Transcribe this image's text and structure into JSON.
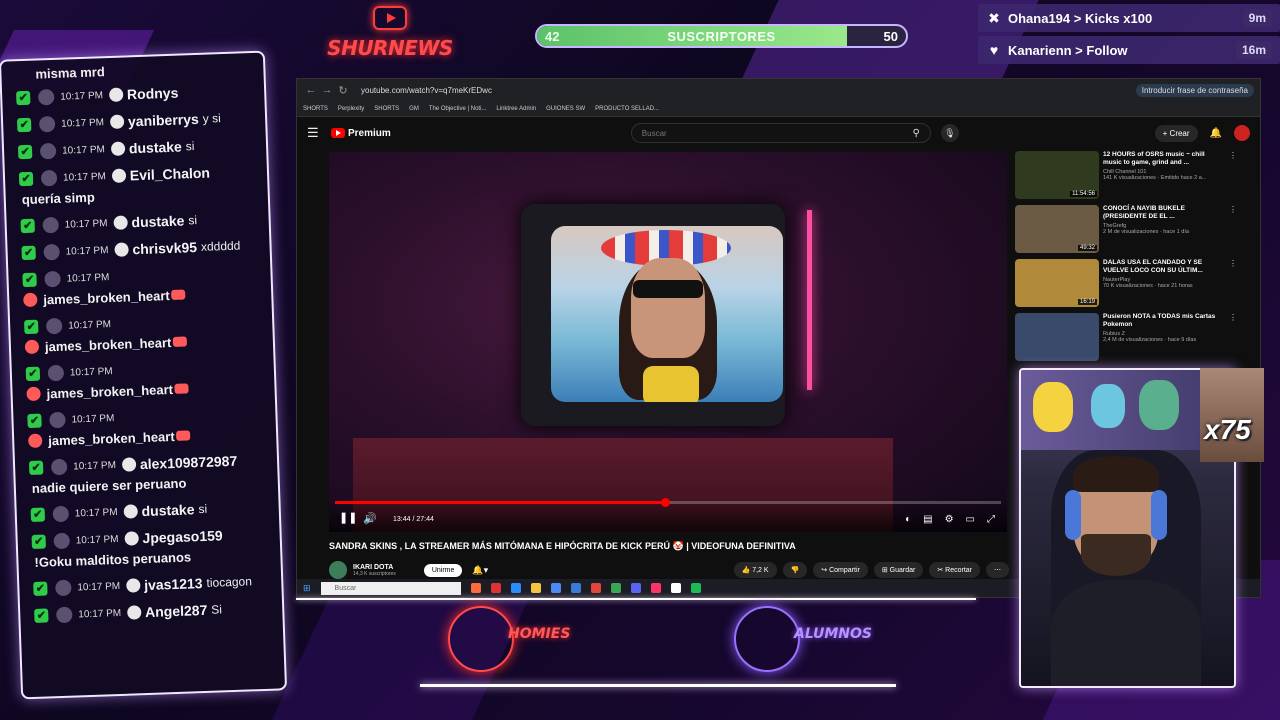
{
  "overlay": {
    "brand": "SHURNEWS",
    "subscribers": {
      "current": "42",
      "label": "SUSCRIPTORES",
      "goal": "50",
      "progress_fraction": 0.84
    },
    "alerts": [
      {
        "icon": "kick-icon",
        "text": "Ohana194 > Kicks x100",
        "time": "9m"
      },
      {
        "icon": "heart-icon",
        "text": "Kanarienn > Follow",
        "time": "16m"
      }
    ],
    "multiplier": "x75",
    "bottom_logos": {
      "homies": "HOMIES",
      "alumnos": "ALUMNOS"
    }
  },
  "chat": {
    "header_fragment": "misma mrd",
    "messages": [
      {
        "time": "10:17 PM",
        "user": "Rodnys",
        "text": "",
        "line2": ""
      },
      {
        "time": "10:17 PM",
        "user": "yaniberrys",
        "text": "y si",
        "line2": ""
      },
      {
        "time": "10:17 PM",
        "user": "dustake",
        "text": "si",
        "line2": ""
      },
      {
        "time": "10:17 PM",
        "user": "Evil_Chalon",
        "text": "",
        "line2": "quería simp"
      },
      {
        "time": "10:17 PM",
        "user": "dustake",
        "text": "si",
        "line2": ""
      },
      {
        "time": "10:17 PM",
        "user": "chrisvk95",
        "text": "xddddd",
        "line2": ""
      },
      {
        "time": "10:17 PM",
        "user": "",
        "text": "",
        "line2": "james_broken_heart"
      },
      {
        "time": "10:17 PM",
        "user": "",
        "text": "",
        "line2": "james_broken_heart"
      },
      {
        "time": "10:17 PM",
        "user": "",
        "text": "",
        "line2": "james_broken_heart"
      },
      {
        "time": "10:17 PM",
        "user": "",
        "text": "",
        "line2": "james_broken_heart"
      },
      {
        "time": "10:17 PM",
        "user": "alex109872987",
        "text": "",
        "line2": "nadie quiere ser peruano"
      },
      {
        "time": "10:17 PM",
        "user": "dustake",
        "text": "si",
        "line2": ""
      },
      {
        "time": "10:17 PM",
        "user": "Jpegaso159",
        "text": "",
        "line2": "!Goku malditos peruanos"
      },
      {
        "time": "10:17 PM",
        "user": "jvas1213",
        "text": "tiocagon",
        "line2": ""
      },
      {
        "time": "10:17 PM",
        "user": "Angel287",
        "text": "Si",
        "line2": ""
      }
    ]
  },
  "browser": {
    "url": "youtube.com/watch?v=q7meKrEDwc",
    "password_chip": "Introducir frase de contraseña",
    "bookmarks": [
      "SHORTS",
      "Perplexity",
      "SHORTS",
      "GM",
      "The Objective | Noti...",
      "Linktree Admin",
      "GUIONES SW",
      "PRODUCTO SELLAD..."
    ],
    "youtube": {
      "logo": "Premium",
      "search_placeholder": "Buscar",
      "create": "+ Crear",
      "time": "13:44 / 27:44",
      "progress_fraction": 0.495,
      "title": "SANDRA SKINS , LA STREAMER MÁS MITÓMANA E HIPÓCRITA DE KICK PERÚ 🤡 | VIDEOFUNA DEFINITIVA",
      "channel": "IKARI DOTA",
      "channel_subs": "14,3 K suscriptores",
      "join": "Unirme",
      "likes": "7,2 K",
      "share": "Compartir",
      "save": "Guardar",
      "clip": "Recortar",
      "recommendations": [
        {
          "title": "12 HOURS of OSRS music ~ chill music to game, grind and ...",
          "channel": "Chill Channel 101",
          "views": "141 K visualizaciones · Emitido hace 2 a...",
          "duration": "11:54:56",
          "color": "#2f3a1f"
        },
        {
          "title": "CONOCÍ A NAYIB BUKELE (PRESIDENTE DE EL ...",
          "channel": "TheGrefg",
          "views": "2 M de visualizaciones · hace 1 día",
          "duration": "49:32",
          "color": "#6b5a44"
        },
        {
          "title": "DALAS USA EL CANDADO Y SE VUELVE LOCO CON SU ÚLTIM...",
          "channel": "NauterPlay",
          "views": "70 K visualizaciones · hace 21 horas",
          "duration": "16:19",
          "color": "#b08a3a"
        },
        {
          "title": "Pusieron NOTA a TODAS mis Cartas Pokemon",
          "channel": "Rubius Z",
          "views": "2,4 M de visualizaciones · hace 9 días",
          "duration": "",
          "color": "#3a4a6a"
        }
      ]
    },
    "taskbar_search": "Buscar"
  }
}
